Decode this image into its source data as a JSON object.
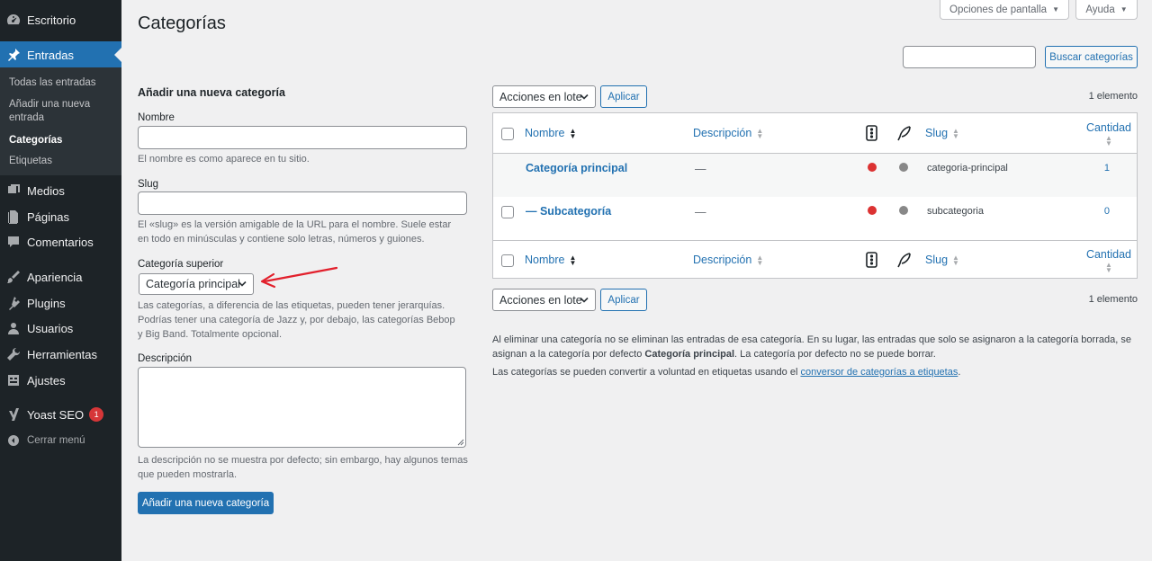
{
  "sidebar": {
    "items": [
      {
        "label": "Escritorio",
        "icon": "dashboard-icon"
      },
      {
        "label": "Entradas",
        "icon": "pin-icon"
      },
      {
        "label": "Medios",
        "icon": "media-icon"
      },
      {
        "label": "Páginas",
        "icon": "pages-icon"
      },
      {
        "label": "Comentarios",
        "icon": "comments-icon"
      },
      {
        "label": "Apariencia",
        "icon": "appearance-icon"
      },
      {
        "label": "Plugins",
        "icon": "plugins-icon"
      },
      {
        "label": "Usuarios",
        "icon": "users-icon"
      },
      {
        "label": "Herramientas",
        "icon": "tools-icon"
      },
      {
        "label": "Ajustes",
        "icon": "settings-icon"
      },
      {
        "label": "Yoast SEO",
        "icon": "yoast-icon",
        "badge": "1"
      }
    ],
    "submenu": [
      {
        "label": "Todas las entradas"
      },
      {
        "label": "Añadir una nueva entrada"
      },
      {
        "label": "Categorías"
      },
      {
        "label": "Etiquetas"
      }
    ],
    "collapse_label": "Cerrar menú"
  },
  "header": {
    "title": "Categorías",
    "screen_options": "Opciones de pantalla",
    "help": "Ayuda"
  },
  "search": {
    "button": "Buscar categorías"
  },
  "form": {
    "heading": "Añadir una nueva categoría",
    "name_label": "Nombre",
    "name_help": "El nombre es como aparece en tu sitio.",
    "slug_label": "Slug",
    "slug_help": "El «slug» es la versión amigable de la URL para el nombre. Suele estar en todo en minúsculas y contiene solo letras, números y guiones.",
    "parent_label": "Categoría superior",
    "parent_value": "Categoría principal",
    "parent_help": "Las categorías, a diferencia de las etiquetas, pueden tener jerarquías. Podrías tener una categoría de Jazz y, por debajo, las categorías Bebop y Big Band. Totalmente opcional.",
    "desc_label": "Descripción",
    "desc_help": "La descripción no se muestra por defecto; sin embargo, hay algunos temas que pueden mostrarla.",
    "submit": "Añadir una nueva categoría"
  },
  "table": {
    "bulk_label": "Acciones en lote",
    "apply": "Aplicar",
    "count": "1 elemento",
    "columns": {
      "name": "Nombre",
      "description": "Descripción",
      "slug": "Slug",
      "count": "Cantidad"
    },
    "rows": [
      {
        "name": "Categoría principal",
        "description": "—",
        "slug": "categoria-principal",
        "count": "1"
      },
      {
        "name": "— Subcategoría",
        "description": "—",
        "slug": "subcategoria",
        "count": "0"
      }
    ],
    "colors": {
      "seo_dot": "#dc3232",
      "readability_dot": "#888888"
    }
  },
  "notes": {
    "line1_a": "Al eliminar una categoría no se eliminan las entradas de esa categoría. En su lugar, las entradas que solo se asignaron a la categoría borrada, se asignan a la categoría por defecto ",
    "line1_bold": "Categoría principal",
    "line1_b": ". La categoría por defecto no se puede borrar.",
    "line2_a": "Las categorías se pueden convertir a voluntad en etiquetas usando el ",
    "line2_link": "conversor de categorías a etiquetas",
    "line2_b": "."
  }
}
